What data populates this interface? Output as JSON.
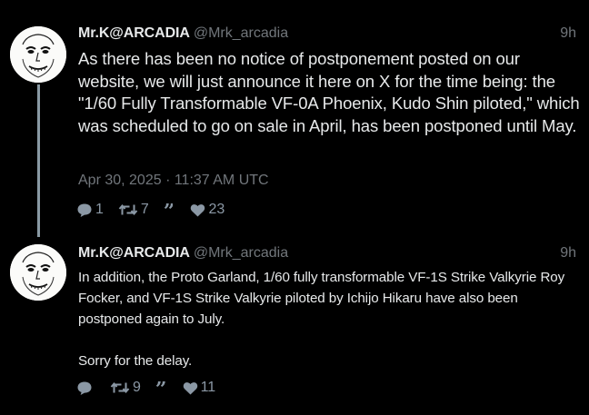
{
  "thread": [
    {
      "author": {
        "display_name": "Mr.K@ARCADIA",
        "handle": "@Mrk_arcadia"
      },
      "age": "9h",
      "text": "As there has been no notice of postponement posted on our website, we will just announce it here on X for the time being: the \"1/60 Fully Transformable VF-0A Phoenix, Kudo Shin piloted,\" which was scheduled to go on sale in April, has been postponed until May.",
      "timestamp": "Apr 30, 2025 · 11:37 AM UTC",
      "stats": {
        "replies": "1",
        "reposts": "7",
        "quotes": "",
        "likes": "23"
      }
    },
    {
      "author": {
        "display_name": "Mr.K@ARCADIA",
        "handle": "@Mrk_arcadia"
      },
      "age": "9h",
      "text": "In addition, the Proto Garland, 1/60 fully transformable VF-1S Strike Valkyrie Roy Focker, and VF-1S Strike Valkyrie piloted by Ichijo Hikaru have also been postponed again to July.\n\nSorry for the delay.",
      "stats": {
        "replies": "",
        "reposts": "9",
        "quotes": "",
        "likes": "11"
      }
    }
  ],
  "icons": {
    "reply": "comment-bubble-icon",
    "repost": "retweet-arrows-icon",
    "quote": "quote-marks-icon",
    "like": "heart-icon",
    "avatar": "sketched-face-avatar"
  },
  "colors": {
    "background": "#000000",
    "text": "#e7e9ea",
    "muted": "#71767b",
    "action": "#8b98a5",
    "thread_line": "#8a9aa4"
  }
}
